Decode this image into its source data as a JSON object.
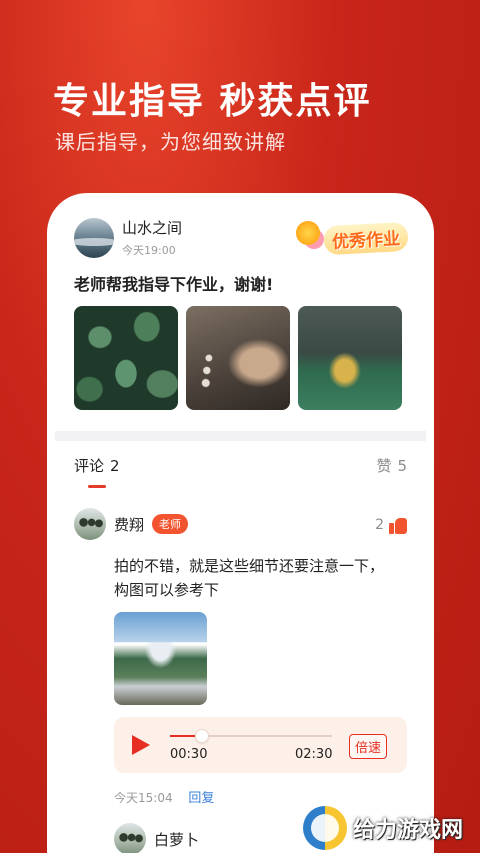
{
  "hero": {
    "title": "专业指导 秒获点评",
    "subtitle": "课后指导，为您细致讲解"
  },
  "post": {
    "username": "山水之间",
    "time": "今天19:00",
    "badge": "优秀作业",
    "text": "老师帮我指导下作业，谢谢!",
    "photos": [
      "leaves",
      "soil-in-hands",
      "lake-trees"
    ]
  },
  "tabs": {
    "comments_label": "评论",
    "comments_count": "2",
    "likes_label": "赞",
    "likes_count": "5"
  },
  "comment1": {
    "name": "费翔",
    "tag": "老师",
    "likes": "2",
    "body_line1": "拍的不错，就是这些细节还要注意一下，",
    "body_line2": "构图可以参考下",
    "audio": {
      "current": "00:30",
      "total": "02:30",
      "speed_label": "倍速",
      "progress": 0.2
    },
    "time": "今天15:04",
    "reply_label": "回复"
  },
  "comment2": {
    "name": "白萝卜"
  },
  "watermark": {
    "text": "给力游戏网"
  },
  "colors": {
    "brand_red": "#c9261a",
    "accent": "#e62e22",
    "teacher_tag": "#f2542f",
    "reply_link": "#3b7fd8"
  },
  "icons": [
    "play-icon",
    "thumb-up-icon"
  ]
}
